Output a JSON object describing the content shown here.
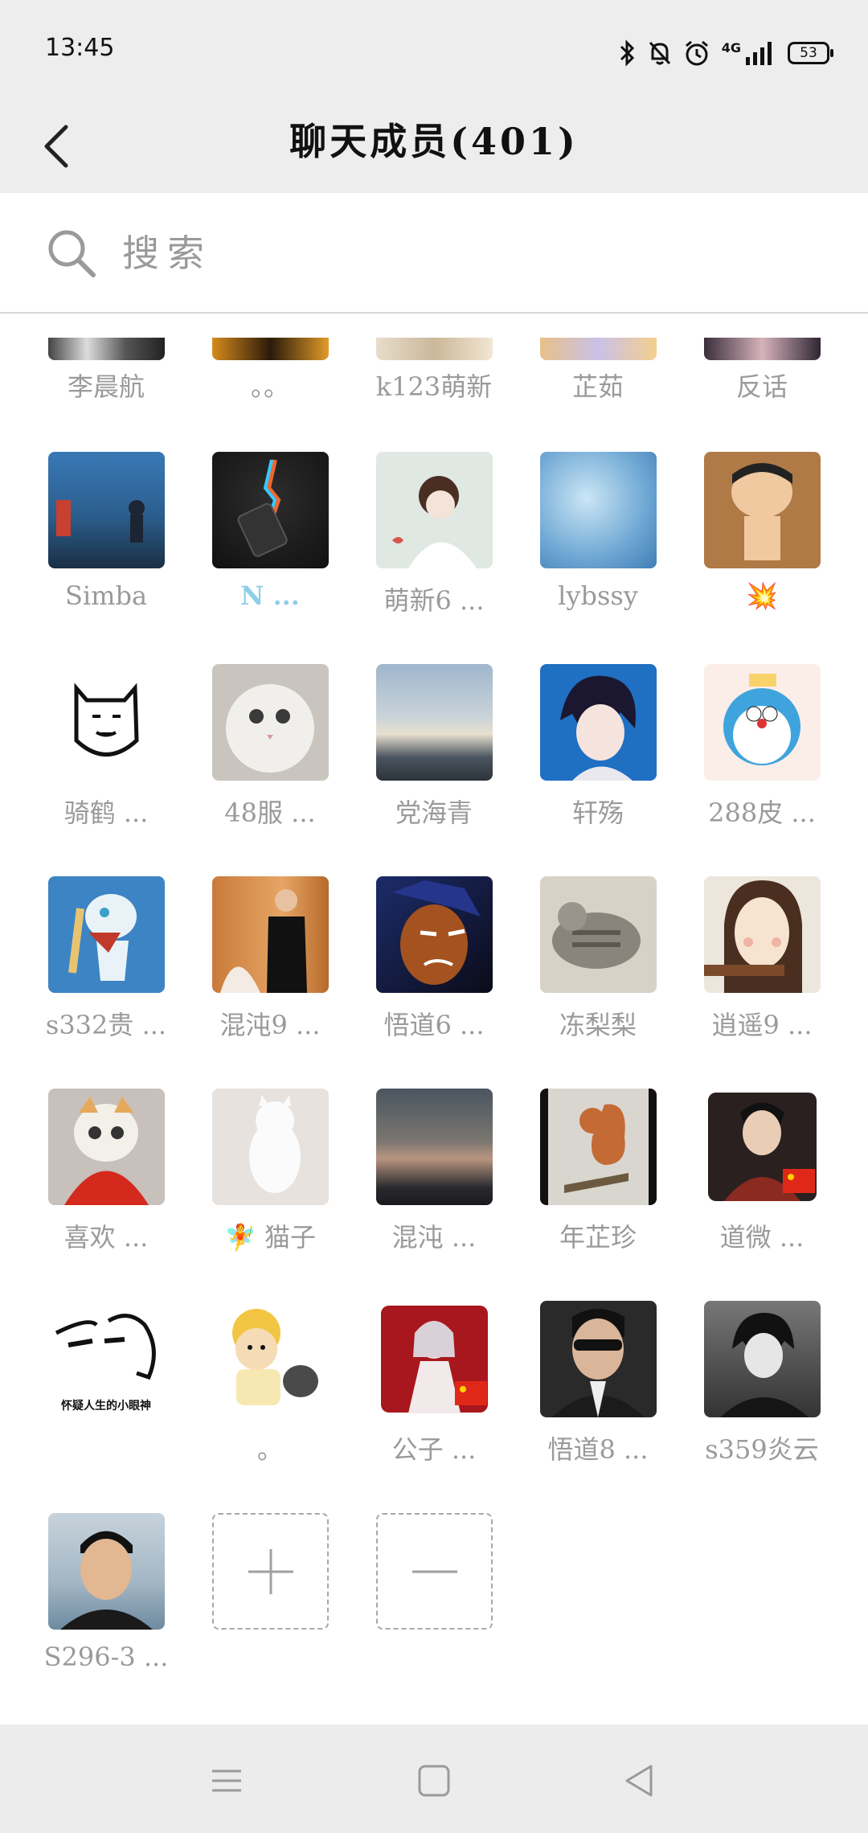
{
  "status": {
    "time": "13:45",
    "network": "4G",
    "battery": "53",
    "icons": [
      "bluetooth-icon",
      "mute-bell-icon",
      "alarm-icon",
      "signal-icon",
      "battery-icon"
    ]
  },
  "header": {
    "title": "聊天成员(401)",
    "back_icon": "back-chevron-icon"
  },
  "search": {
    "placeholder": "搜索",
    "value": ""
  },
  "members": {
    "partial_row": [
      "李晨航",
      "。。",
      "k123萌新",
      "芷茹",
      "反话"
    ],
    "rows": [
      [
        "Simba",
        "N ...",
        "萌新6 ...",
        "lybssy",
        "💥"
      ],
      [
        "骑鹤 ...",
        "48服 ...",
        "党海青",
        "轩殇",
        "288皮 ..."
      ],
      [
        "s332贵 ...",
        "混沌9 ...",
        "悟道6 ...",
        "冻梨梨",
        "逍遥9 ..."
      ],
      [
        "喜欢 ...",
        "🧚 猫子",
        "混沌 ...",
        "年芷珍",
        "道微 ..."
      ],
      [
        "",
        "。",
        "公子 ...",
        "悟道8 ...",
        "s359炎云"
      ],
      [
        "S296-3 ..."
      ]
    ],
    "sticker_caption": "怀疑人生的小眼神"
  },
  "actions": {
    "add_icon": "plus-icon",
    "remove_icon": "minus-icon"
  },
  "bottom_nav": [
    "menu-icon",
    "home-icon",
    "back-triangle-icon"
  ]
}
